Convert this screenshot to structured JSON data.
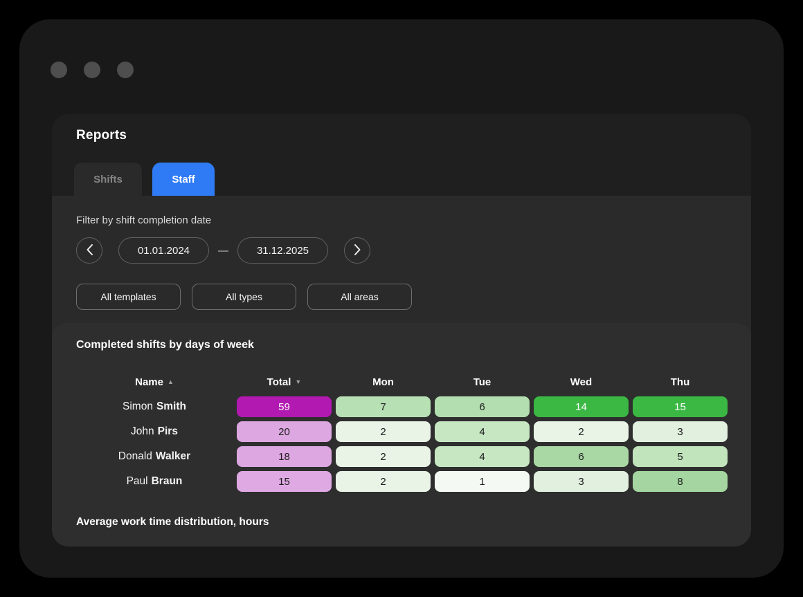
{
  "header": {
    "title": "Reports"
  },
  "tabs": {
    "shifts": "Shifts",
    "staff": "Staff"
  },
  "filters": {
    "label": "Filter by shift completion date",
    "date_from": "01.01.2024",
    "date_to": "31.12.2025",
    "separator": "—",
    "templates": "All templates",
    "types": "All types",
    "areas": "All areas"
  },
  "table": {
    "title": "Completed shifts by days of week",
    "columns": {
      "name": "Name",
      "total": "Total",
      "mon": "Mon",
      "tue": "Tue",
      "wed": "Wed",
      "thu": "Thu"
    },
    "icons": {
      "sort_asc": "▲",
      "sort_desc": "▼"
    },
    "rows": [
      {
        "first": "Simon",
        "last": "Smith",
        "cells": [
          {
            "v": "59",
            "bg": "#b119b1",
            "fg": "#ffffff"
          },
          {
            "v": "7",
            "bg": "#b7e0b4",
            "fg": "#1c1c1c"
          },
          {
            "v": "6",
            "bg": "#b3deb0",
            "fg": "#1c1c1c"
          },
          {
            "v": "14",
            "bg": "#3bb843",
            "fg": "#ffffff"
          },
          {
            "v": "15",
            "bg": "#3bb843",
            "fg": "#ffffff"
          }
        ]
      },
      {
        "first": "John",
        "last": "Pirs",
        "cells": [
          {
            "v": "20",
            "bg": "#dda7e1",
            "fg": "#1c1c1c"
          },
          {
            "v": "2",
            "bg": "#e9f4e7",
            "fg": "#1c1c1c"
          },
          {
            "v": "4",
            "bg": "#c7e7c3",
            "fg": "#1c1c1c"
          },
          {
            "v": "2",
            "bg": "#e9f4e7",
            "fg": "#1c1c1c"
          },
          {
            "v": "3",
            "bg": "#e2f0df",
            "fg": "#1c1c1c"
          }
        ]
      },
      {
        "first": "Donald",
        "last": "Walker",
        "cells": [
          {
            "v": "18",
            "bg": "#dda7e1",
            "fg": "#1c1c1c"
          },
          {
            "v": "2",
            "bg": "#e9f4e7",
            "fg": "#1c1c1c"
          },
          {
            "v": "4",
            "bg": "#c7e7c3",
            "fg": "#1c1c1c"
          },
          {
            "v": "6",
            "bg": "#a9d8a5",
            "fg": "#1c1c1c"
          },
          {
            "v": "5",
            "bg": "#c1e4bd",
            "fg": "#1c1c1c"
          }
        ]
      },
      {
        "first": "Paul",
        "last": "Braun",
        "cells": [
          {
            "v": "15",
            "bg": "#dfaae3",
            "fg": "#1c1c1c"
          },
          {
            "v": "2",
            "bg": "#e9f4e7",
            "fg": "#1c1c1c"
          },
          {
            "v": "1",
            "bg": "#f4faf3",
            "fg": "#1c1c1c"
          },
          {
            "v": "3",
            "bg": "#e2f0df",
            "fg": "#1c1c1c"
          },
          {
            "v": "8",
            "bg": "#a5d6a1",
            "fg": "#1c1c1c"
          }
        ]
      }
    ]
  },
  "footer": {
    "title": "Average work time distribution, hours"
  },
  "colors": {
    "accent_blue": "#2f7bf5",
    "magenta": "#b119b1",
    "green_strong": "#3bb843"
  }
}
